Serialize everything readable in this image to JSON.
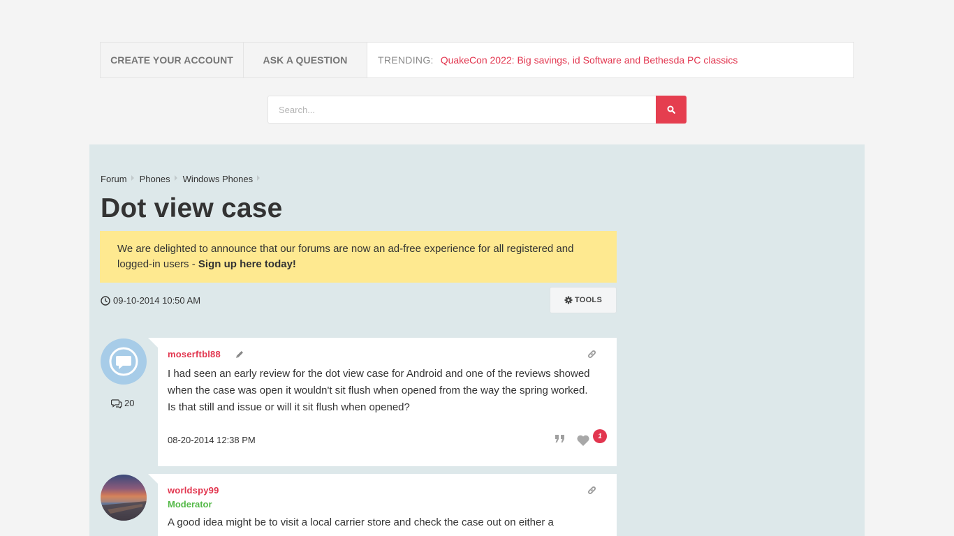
{
  "topnav": {
    "create_account": "CREATE YOUR ACCOUNT",
    "ask_question": "ASK A QUESTION",
    "trending_label": "TRENDING:",
    "trending_link": "QuakeCon 2022: Big savings, id Software and Bethesda PC classics"
  },
  "search": {
    "placeholder": "Search..."
  },
  "breadcrumb": [
    "Forum",
    "Phones",
    "Windows Phones"
  ],
  "thread": {
    "title": "Dot view case",
    "date": "09-10-2014 10:50 AM",
    "tools_label": "TOOLS"
  },
  "announcement": {
    "text": "We are delighted to announce that our forums are now an ad-free experience for all registered and logged-in users - ",
    "link": "Sign up here today!"
  },
  "posts": [
    {
      "username": "moserftbl88",
      "post_count": "20",
      "body": "I had seen an early review for the dot view case for Android and one of the reviews showed when the case was open it wouldn't sit flush when opened from the way the spring worked. Is that still and issue or will it sit flush when opened?",
      "date": "08-20-2014 12:38 PM",
      "likes": "1"
    },
    {
      "username": "worldspy99",
      "role": "Moderator",
      "body": "A good idea might be to visit a local carrier store and check the case out on either a"
    }
  ],
  "colors": {
    "accent": "#e2364f",
    "announcement_bg": "#fee990",
    "main_bg": "#dde8ea",
    "moderator": "#54b948"
  }
}
